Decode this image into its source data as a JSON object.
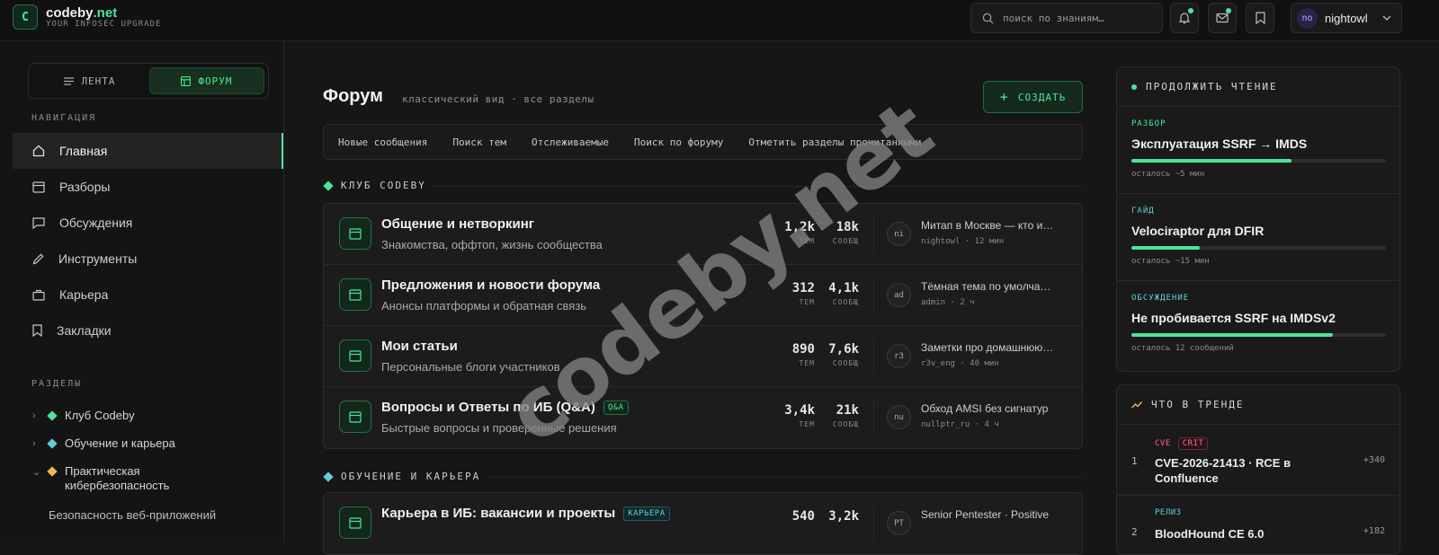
{
  "colors": {
    "accent": "#4ee59a",
    "teal": "#5fd0d8",
    "amber": "#f0b84a",
    "crit": "#ff6b85"
  },
  "header": {
    "logo_letter": "C",
    "brand_main": "codeby",
    "brand_tld": ".net",
    "tagline": "YOUR INFOSEC UPGRADE",
    "search_placeholder": "поиск по знаниям…",
    "user_initials": "no",
    "username": "nightowl",
    "icons": [
      "bell-icon",
      "mail-icon",
      "bookmark-icon",
      "chevron-down-icon"
    ]
  },
  "sidebar": {
    "segment": {
      "feed": "ЛЕНТА",
      "forum": "ФОРУМ",
      "active": "forum"
    },
    "nav_heading": "НАВИГАЦИЯ",
    "nav": [
      {
        "label": "Главная",
        "icon": "home-icon",
        "active": true
      },
      {
        "label": "Разборы",
        "icon": "window-icon"
      },
      {
        "label": "Обсуждения",
        "icon": "chat-icon"
      },
      {
        "label": "Инструменты",
        "icon": "pen-icon"
      },
      {
        "label": "Карьера",
        "icon": "briefcase-icon"
      },
      {
        "label": "Закладки",
        "icon": "bookmark-icon"
      }
    ],
    "sections_heading": "РАЗДЕЛЫ",
    "sections": [
      {
        "label": "Клуб Codeby",
        "color": "#4ee59a",
        "expanded": false
      },
      {
        "label": "Обучение и карьера",
        "color": "#5fd0d8",
        "expanded": false
      },
      {
        "label": "Практическая кибербезопасность",
        "color": "#f0b84a",
        "expanded": true
      }
    ],
    "subsection": "Безопасность веб-приложений"
  },
  "main": {
    "title": "Форум",
    "subtitle": "классический вид · все разделы",
    "create_label": "СОЗДАТЬ",
    "tabs": [
      "Новые сообщения",
      "Поиск тем",
      "Отслеживаемые",
      "Поиск по форуму",
      "Отметить разделы прочитанными"
    ],
    "categories": [
      {
        "title": "КЛУБ CODEBY",
        "color": "#4ee59a",
        "forums": [
          {
            "title": "Общение и нетворкинг",
            "badge": "",
            "desc": "Знакомства, оффтоп, жизнь сообщества",
            "topics": "1,2k",
            "posts": "18k",
            "avatar": "ni",
            "last_title": "Митап в Москве — кто идёт?",
            "last_meta": "nightowl · 12 мин"
          },
          {
            "title": "Предложения и новости форума",
            "badge": "",
            "desc": "Анонсы платформы и обратная связь",
            "topics": "312",
            "posts": "4,1k",
            "avatar": "ad",
            "last_title": "Тёмная тема по умолчанию",
            "last_meta": "admin · 2 ч"
          },
          {
            "title": "Мои статьи",
            "badge": "",
            "desc": "Персональные блоги участников",
            "topics": "890",
            "posts": "7,6k",
            "avatar": "r3",
            "last_title": "Заметки про домашнюю лабу",
            "last_meta": "r3v_eng · 40 мин"
          },
          {
            "title": "Вопросы и Ответы по ИБ (Q&A)",
            "badge": "Q&A",
            "desc": "Быстрые вопросы и проверенные решения",
            "topics": "3,4k",
            "posts": "21k",
            "avatar": "nu",
            "last_title": "Обход AMSI без сигнатур",
            "last_meta": "nullptr_ru · 4 ч"
          }
        ]
      },
      {
        "title": "ОБУЧЕНИЕ И КАРЬЕРА",
        "color": "#5fd0d8",
        "forums": [
          {
            "title": "Карьера в ИБ: вакансии и проекты",
            "badge": "КАРЬЕРА",
            "desc": "",
            "topics": "540",
            "posts": "3,2k",
            "avatar": "PT",
            "last_title": "Senior Pentester · Positive",
            "last_meta": ""
          }
        ]
      }
    ],
    "stat_labels": {
      "topics": "ТЕМ",
      "posts": "СООБЩ"
    }
  },
  "right": {
    "continue": {
      "heading": "ПРОДОЛЖИТЬ ЧТЕНИЕ",
      "items": [
        {
          "tag": "РАЗБОР",
          "tag_color": "#4ee59a",
          "title": "Эксплуатация SSRF → IMDS",
          "progress": 0.63,
          "meta": "осталось ~5 мин"
        },
        {
          "tag": "ГАЙД",
          "tag_color": "#5fd0d8",
          "title": "Velociraptor для DFIR",
          "progress": 0.27,
          "meta": "осталось ~15 мин"
        },
        {
          "tag": "ОБСУЖДЕНИЕ",
          "tag_color": "#5fd0d8",
          "title": "Не пробивается SSRF на IMDSv2",
          "progress": 0.79,
          "meta": "осталось 12 сообщений"
        }
      ]
    },
    "trending": {
      "heading": "ЧТО В ТРЕНДЕ",
      "items": [
        {
          "num": "1",
          "tag": "CVE",
          "tag_color": "#ff6b85",
          "crit": "CRIT",
          "title": "CVE-2026-21413 · RCE в Confluence",
          "score": "+340"
        },
        {
          "num": "2",
          "tag": "РЕЛИЗ",
          "tag_color": "#5fd0d8",
          "crit": "",
          "title": "BloodHound CE 6.0",
          "score": "+182"
        }
      ]
    }
  },
  "watermark": "codeby.net"
}
